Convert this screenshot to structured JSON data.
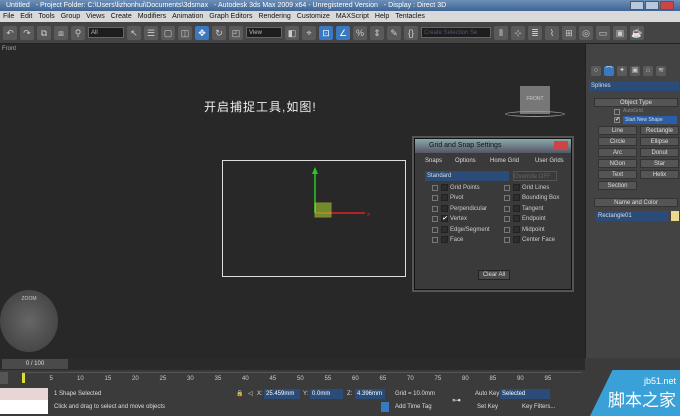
{
  "titlebar": {
    "doc": "Untitled",
    "project": "- Project Folder: C:\\Users\\lizhonhui\\Documents\\3dsmax",
    "app": "- Autodesk 3ds Max 2009 x64 - Unregistered Version",
    "display": "- Display : Direct 3D"
  },
  "menu": [
    "File",
    "Edit",
    "Tools",
    "Group",
    "Views",
    "Create",
    "Modifiers",
    "Animation",
    "Graph Editors",
    "Rendering",
    "Customize",
    "MAXScript",
    "Help",
    "Tentacles"
  ],
  "toolbar": {
    "filter": "All",
    "refcoord": "View",
    "selset": "Create Selection Se"
  },
  "viewport": {
    "label": "Front",
    "caption": "开启捕捉工具,如图!",
    "viewcube": "FRONT",
    "navwheel": "ZOOM"
  },
  "command_panel": {
    "category": "Splines",
    "rollout_object_type": "Object Type",
    "autogrid_label": "AutoGrid",
    "start_new_shape": "Start New Shape",
    "buttons": [
      "Line",
      "Rectangle",
      "Circle",
      "Ellipse",
      "Arc",
      "Donut",
      "NGon",
      "Star",
      "Text",
      "Helix",
      "Section"
    ],
    "rollout_name": "Name and Color",
    "object_name": "Rectangle01",
    "object_color": "#e8d890"
  },
  "dialog": {
    "title": "Grid and Snap Settings",
    "tabs": [
      "Snaps",
      "Options",
      "Home Grid",
      "User Grids"
    ],
    "preset": "Standard",
    "override": "Override OFF",
    "snaps_left": [
      {
        "label": "Grid Points",
        "checked": false
      },
      {
        "label": "Pivot",
        "checked": false
      },
      {
        "label": "Perpendicular",
        "checked": false
      },
      {
        "label": "Vertex",
        "checked": true
      },
      {
        "label": "Edge/Segment",
        "checked": false
      },
      {
        "label": "Face",
        "checked": false
      }
    ],
    "snaps_right": [
      {
        "label": "Grid Lines",
        "checked": false
      },
      {
        "label": "Bounding Box",
        "checked": false
      },
      {
        "label": "Tangent",
        "checked": false
      },
      {
        "label": "Endpoint",
        "checked": false
      },
      {
        "label": "Midpoint",
        "checked": false
      },
      {
        "label": "Center Face",
        "checked": false
      }
    ],
    "clear_all": "Clear All",
    "check": "✔"
  },
  "timeline": {
    "frame": "0 / 100",
    "ticks": [
      "5",
      "10",
      "15",
      "20",
      "25",
      "30",
      "35",
      "40",
      "45",
      "50",
      "55",
      "60",
      "65",
      "70",
      "75",
      "80",
      "85",
      "90",
      "95"
    ]
  },
  "status": {
    "selected": "1 Shape Selected",
    "prompt": "Click and drag to select and move objects",
    "x_label": "X:",
    "x": "25.459mm",
    "y_label": "Y:",
    "y": "0.0mm",
    "z_label": "Z:",
    "z": "4.396mm",
    "grid": "Grid = 10.0mm",
    "add_time_tag": "Add Time Tag",
    "auto_key": "Auto Key",
    "selected_dd": "Selected",
    "set_key": "Set Key",
    "key_filters": "Key Filters..."
  },
  "watermark": {
    "site": "jb51.net",
    "name": "脚本之家"
  }
}
